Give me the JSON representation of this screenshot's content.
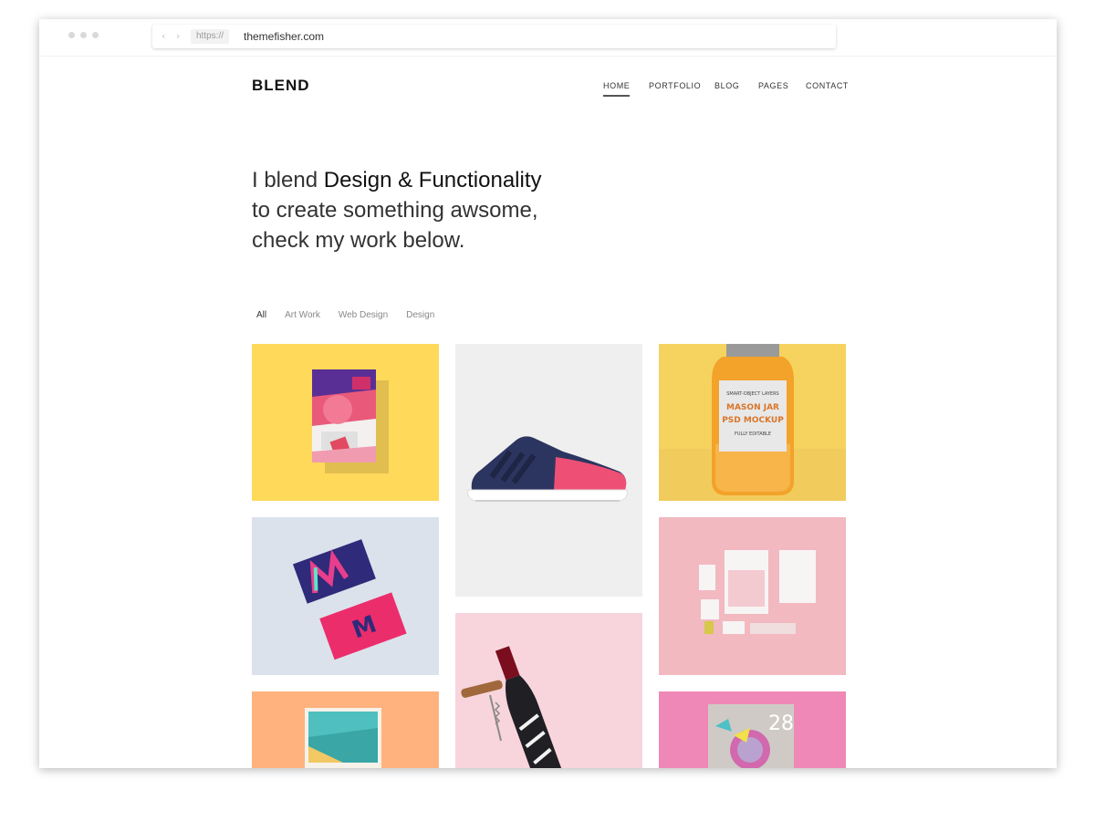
{
  "browser": {
    "protocol": "https://",
    "host": "themefisher.com"
  },
  "site": {
    "logo": "BLEND"
  },
  "nav": {
    "items": [
      {
        "label": "HOME",
        "active": true
      },
      {
        "label": "PORTFOLIO",
        "active": false
      },
      {
        "label": "BLOG",
        "active": false
      },
      {
        "label": "PAGES",
        "active": false
      },
      {
        "label": "CONTACT",
        "active": false
      }
    ]
  },
  "hero": {
    "line1_pre": "I blend ",
    "line1_strong": "Design & Functionality",
    "line2": "to create something awsome,",
    "line3": "check my work below."
  },
  "filters": {
    "items": [
      "All",
      "Art Work",
      "Web Design",
      "Design"
    ],
    "active": "All"
  },
  "portfolio": {
    "jar_label_line1": "SMART-OBJECT LAYERS",
    "jar_label_line2": "MASON JAR",
    "jar_label_line3": "PSD MOCKUP",
    "jar_label_line4": "FULLY EDITABLE",
    "card_number": "28"
  },
  "colors": {
    "tile_yellow": "#ffd95a",
    "tile_gray": "#efefef",
    "tile_jar": "#f5d35e",
    "tile_blue": "#dbe2ec",
    "tile_pink": "#f2b9c0",
    "tile_orange": "#ffb27e",
    "tile_lightpink": "#f8d5dc",
    "tile_magenta": "#ef88b6"
  }
}
